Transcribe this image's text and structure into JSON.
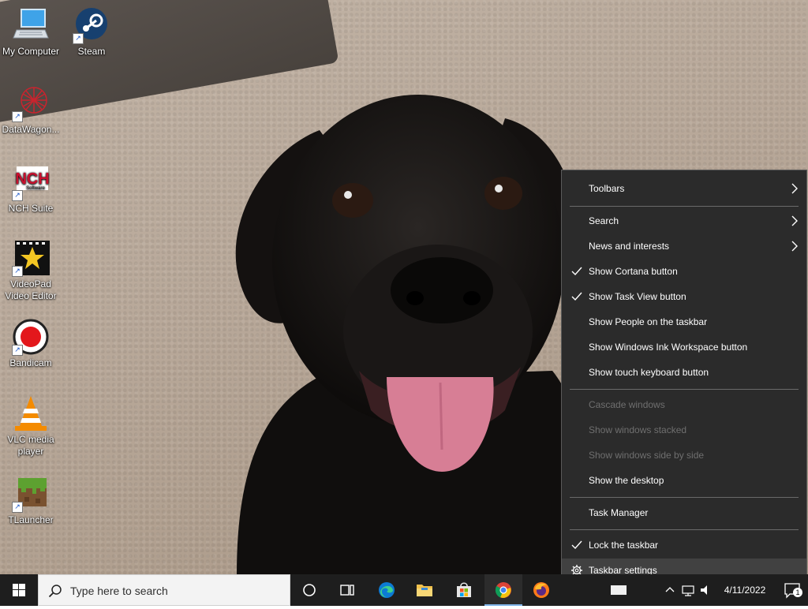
{
  "desktop": {
    "icons": [
      {
        "label": "My Computer"
      },
      {
        "label": "Steam"
      },
      {
        "label": "DataWagon..."
      },
      {
        "label": "NCH Suite"
      },
      {
        "label": "VideoPad Video Editor"
      },
      {
        "label": "Bandicam"
      },
      {
        "label": "VLC media player"
      },
      {
        "label": "TLauncher"
      }
    ]
  },
  "context_menu": {
    "items": [
      {
        "label": "Toolbars",
        "submenu": true
      },
      {
        "label": "Search",
        "submenu": true
      },
      {
        "label": "News and interests",
        "submenu": true
      },
      {
        "label": "Show Cortana button",
        "checked": true
      },
      {
        "label": "Show Task View button",
        "checked": true
      },
      {
        "label": "Show People on the taskbar"
      },
      {
        "label": "Show Windows Ink Workspace button"
      },
      {
        "label": "Show touch keyboard button"
      },
      {
        "label": "Cascade windows",
        "disabled": true
      },
      {
        "label": "Show windows stacked",
        "disabled": true
      },
      {
        "label": "Show windows side by side",
        "disabled": true
      },
      {
        "label": "Show the desktop"
      },
      {
        "label": "Task Manager"
      },
      {
        "label": "Lock the taskbar",
        "checked": true
      },
      {
        "label": "Taskbar settings",
        "icon": "gear-icon",
        "highlighted": true
      }
    ]
  },
  "taskbar": {
    "search_placeholder": "Type here to search",
    "pinned": [
      "cortana-icon",
      "task-view-icon",
      "edge-icon",
      "file-explorer-icon",
      "store-icon",
      "chrome-icon",
      "firefox-icon"
    ],
    "active_app": "chrome-icon",
    "date": "4/11/2022",
    "notification_count": "1"
  },
  "colors": {
    "taskbar_bg": "#1e1e1e",
    "menu_bg": "#2b2b2b",
    "menu_highlight": "#414141",
    "disabled_text": "#6f6f6f"
  }
}
